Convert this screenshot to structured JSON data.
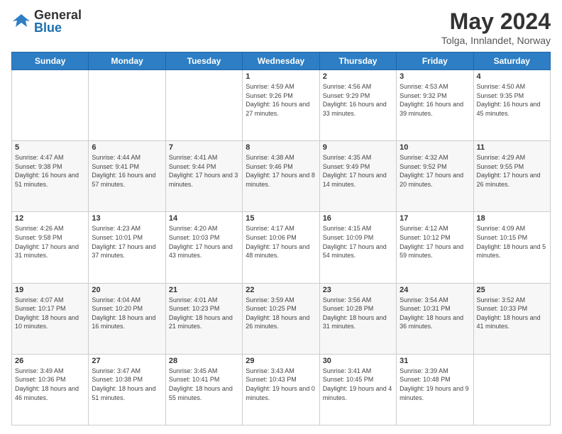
{
  "header": {
    "logo_general": "General",
    "logo_blue": "Blue",
    "title": "May 2024",
    "subtitle": "Tolga, Innlandet, Norway"
  },
  "days_of_week": [
    "Sunday",
    "Monday",
    "Tuesday",
    "Wednesday",
    "Thursday",
    "Friday",
    "Saturday"
  ],
  "weeks": [
    [
      {
        "day": "",
        "info": ""
      },
      {
        "day": "",
        "info": ""
      },
      {
        "day": "",
        "info": ""
      },
      {
        "day": "1",
        "info": "Sunrise: 4:59 AM\nSunset: 9:26 PM\nDaylight: 16 hours\nand 27 minutes."
      },
      {
        "day": "2",
        "info": "Sunrise: 4:56 AM\nSunset: 9:29 PM\nDaylight: 16 hours\nand 33 minutes."
      },
      {
        "day": "3",
        "info": "Sunrise: 4:53 AM\nSunset: 9:32 PM\nDaylight: 16 hours\nand 39 minutes."
      },
      {
        "day": "4",
        "info": "Sunrise: 4:50 AM\nSunset: 9:35 PM\nDaylight: 16 hours\nand 45 minutes."
      }
    ],
    [
      {
        "day": "5",
        "info": "Sunrise: 4:47 AM\nSunset: 9:38 PM\nDaylight: 16 hours\nand 51 minutes."
      },
      {
        "day": "6",
        "info": "Sunrise: 4:44 AM\nSunset: 9:41 PM\nDaylight: 16 hours\nand 57 minutes."
      },
      {
        "day": "7",
        "info": "Sunrise: 4:41 AM\nSunset: 9:44 PM\nDaylight: 17 hours\nand 3 minutes."
      },
      {
        "day": "8",
        "info": "Sunrise: 4:38 AM\nSunset: 9:46 PM\nDaylight: 17 hours\nand 8 minutes."
      },
      {
        "day": "9",
        "info": "Sunrise: 4:35 AM\nSunset: 9:49 PM\nDaylight: 17 hours\nand 14 minutes."
      },
      {
        "day": "10",
        "info": "Sunrise: 4:32 AM\nSunset: 9:52 PM\nDaylight: 17 hours\nand 20 minutes."
      },
      {
        "day": "11",
        "info": "Sunrise: 4:29 AM\nSunset: 9:55 PM\nDaylight: 17 hours\nand 26 minutes."
      }
    ],
    [
      {
        "day": "12",
        "info": "Sunrise: 4:26 AM\nSunset: 9:58 PM\nDaylight: 17 hours\nand 31 minutes."
      },
      {
        "day": "13",
        "info": "Sunrise: 4:23 AM\nSunset: 10:01 PM\nDaylight: 17 hours\nand 37 minutes."
      },
      {
        "day": "14",
        "info": "Sunrise: 4:20 AM\nSunset: 10:03 PM\nDaylight: 17 hours\nand 43 minutes."
      },
      {
        "day": "15",
        "info": "Sunrise: 4:17 AM\nSunset: 10:06 PM\nDaylight: 17 hours\nand 48 minutes."
      },
      {
        "day": "16",
        "info": "Sunrise: 4:15 AM\nSunset: 10:09 PM\nDaylight: 17 hours\nand 54 minutes."
      },
      {
        "day": "17",
        "info": "Sunrise: 4:12 AM\nSunset: 10:12 PM\nDaylight: 17 hours\nand 59 minutes."
      },
      {
        "day": "18",
        "info": "Sunrise: 4:09 AM\nSunset: 10:15 PM\nDaylight: 18 hours\nand 5 minutes."
      }
    ],
    [
      {
        "day": "19",
        "info": "Sunrise: 4:07 AM\nSunset: 10:17 PM\nDaylight: 18 hours\nand 10 minutes."
      },
      {
        "day": "20",
        "info": "Sunrise: 4:04 AM\nSunset: 10:20 PM\nDaylight: 18 hours\nand 16 minutes."
      },
      {
        "day": "21",
        "info": "Sunrise: 4:01 AM\nSunset: 10:23 PM\nDaylight: 18 hours\nand 21 minutes."
      },
      {
        "day": "22",
        "info": "Sunrise: 3:59 AM\nSunset: 10:25 PM\nDaylight: 18 hours\nand 26 minutes."
      },
      {
        "day": "23",
        "info": "Sunrise: 3:56 AM\nSunset: 10:28 PM\nDaylight: 18 hours\nand 31 minutes."
      },
      {
        "day": "24",
        "info": "Sunrise: 3:54 AM\nSunset: 10:31 PM\nDaylight: 18 hours\nand 36 minutes."
      },
      {
        "day": "25",
        "info": "Sunrise: 3:52 AM\nSunset: 10:33 PM\nDaylight: 18 hours\nand 41 minutes."
      }
    ],
    [
      {
        "day": "26",
        "info": "Sunrise: 3:49 AM\nSunset: 10:36 PM\nDaylight: 18 hours\nand 46 minutes."
      },
      {
        "day": "27",
        "info": "Sunrise: 3:47 AM\nSunset: 10:38 PM\nDaylight: 18 hours\nand 51 minutes."
      },
      {
        "day": "28",
        "info": "Sunrise: 3:45 AM\nSunset: 10:41 PM\nDaylight: 18 hours\nand 55 minutes."
      },
      {
        "day": "29",
        "info": "Sunrise: 3:43 AM\nSunset: 10:43 PM\nDaylight: 19 hours\nand 0 minutes."
      },
      {
        "day": "30",
        "info": "Sunrise: 3:41 AM\nSunset: 10:45 PM\nDaylight: 19 hours\nand 4 minutes."
      },
      {
        "day": "31",
        "info": "Sunrise: 3:39 AM\nSunset: 10:48 PM\nDaylight: 19 hours\nand 9 minutes."
      },
      {
        "day": "",
        "info": ""
      }
    ]
  ]
}
